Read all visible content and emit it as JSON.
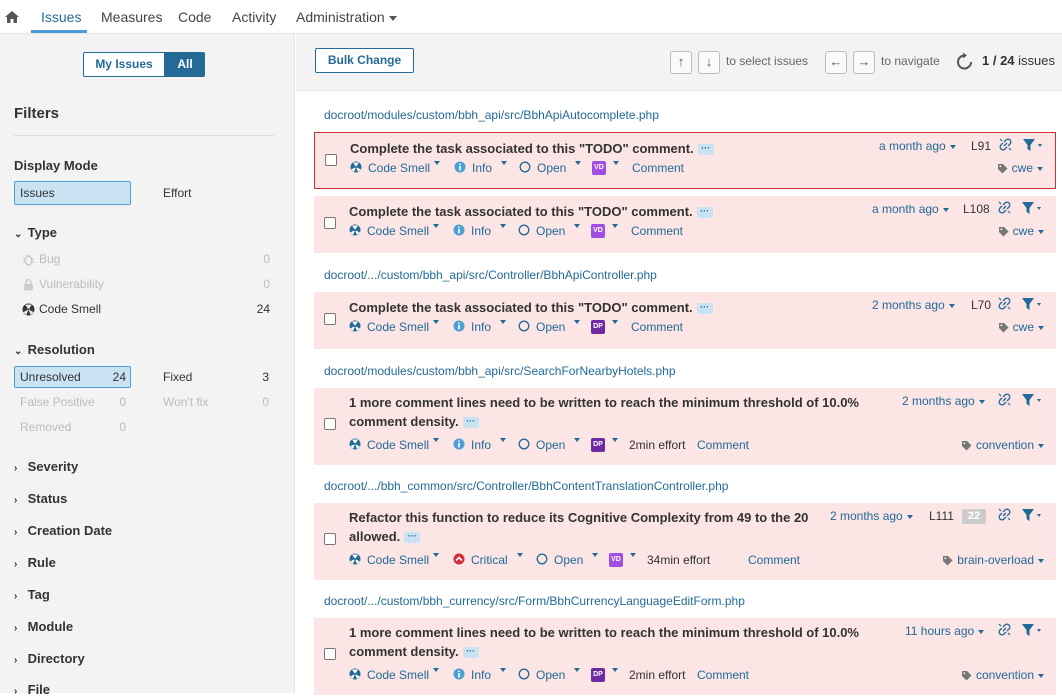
{
  "nav": {
    "items": [
      "Issues",
      "Measures",
      "Code",
      "Activity",
      "Administration"
    ]
  },
  "sidebar": {
    "my_issues": "My Issues",
    "all": "All",
    "filters_title": "Filters",
    "display_mode": {
      "title": "Display Mode",
      "issues": "Issues",
      "effort": "Effort"
    },
    "type": {
      "title": "Type",
      "items": [
        {
          "label": "Bug",
          "count": "0"
        },
        {
          "label": "Vulnerability",
          "count": "0"
        },
        {
          "label": "Code Smell",
          "count": "24"
        }
      ]
    },
    "resolution": {
      "title": "Resolution",
      "items": [
        {
          "label": "Unresolved",
          "count": "24"
        },
        {
          "label": "Fixed",
          "count": "3"
        },
        {
          "label": "False Positive",
          "count": "0"
        },
        {
          "label": "Won't fix",
          "count": "0"
        },
        {
          "label": "Removed",
          "count": "0"
        }
      ]
    },
    "collapsed": [
      "Severity",
      "Status",
      "Creation Date",
      "Rule",
      "Tag",
      "Module",
      "Directory",
      "File"
    ]
  },
  "toolbar": {
    "bulk_change": "Bulk Change",
    "key_up": "↑",
    "key_down": "↓",
    "select_hint": "to select issues",
    "key_left": "←",
    "key_right": "→",
    "navigate_hint": "to navigate",
    "paging_current": "1 / 24",
    "paging_label": "issues"
  },
  "files": [
    "docroot/modules/custom/bbh_api/src/BbhApiAutocomplete.php",
    "docroot/.../custom/bbh_api/src/Controller/BbhApiController.php",
    "docroot/modules/custom/bbh_api/src/SearchForNearbyHotels.php",
    "docroot/.../bbh_common/src/Controller/BbhContentTranslationController.php",
    "docroot/.../custom/bbh_currency/src/Form/BbhCurrencyLanguageEditForm.php"
  ],
  "issues": [
    {
      "msg1": "Complete the task associated to this \"TODO\" comment.",
      "msg2": "",
      "type": "Code Smell",
      "severity": "Info",
      "status": "Open",
      "assignee": "VD",
      "effort": "",
      "comment": "Comment",
      "age": "a month ago",
      "line": "L91",
      "badge": "",
      "tag": "cwe"
    },
    {
      "msg1": "Complete the task associated to this \"TODO\" comment.",
      "msg2": "",
      "type": "Code Smell",
      "severity": "Info",
      "status": "Open",
      "assignee": "VD",
      "effort": "",
      "comment": "Comment",
      "age": "a month ago",
      "line": "L108",
      "badge": "",
      "tag": "cwe"
    },
    {
      "msg1": "Complete the task associated to this \"TODO\" comment.",
      "msg2": "",
      "type": "Code Smell",
      "severity": "Info",
      "status": "Open",
      "assignee": "DP",
      "effort": "",
      "comment": "Comment",
      "age": "2 months ago",
      "line": "L70",
      "badge": "",
      "tag": "cwe"
    },
    {
      "msg1": "1 more comment lines need to be written to reach the minimum threshold of 10.0%",
      "msg2": "comment density.",
      "type": "Code Smell",
      "severity": "Info",
      "status": "Open",
      "assignee": "DP",
      "effort": "2min effort",
      "comment": "Comment",
      "age": "2 months ago",
      "line": "",
      "badge": "",
      "tag": "convention"
    },
    {
      "msg1": "Refactor this function to reduce its Cognitive Complexity from 49 to the 20",
      "msg2": "allowed.",
      "type": "Code Smell",
      "severity": "Critical",
      "status": "Open",
      "assignee": "VD",
      "effort": "34min effort",
      "comment": "Comment",
      "age": "2 months ago",
      "line": "L111",
      "badge": "22",
      "tag": "brain-overload"
    },
    {
      "msg1": "1 more comment lines need to be written to reach the minimum threshold of 10.0%",
      "msg2": "comment density.",
      "type": "Code Smell",
      "severity": "Info",
      "status": "Open",
      "assignee": "DP",
      "effort": "2min effort",
      "comment": "Comment",
      "age": "11 hours ago",
      "line": "",
      "badge": "",
      "tag": "convention"
    }
  ],
  "colors": {
    "accent": "#236a97",
    "issue_bg": "#fbe5e5",
    "selected_border": "#d02f3a",
    "critical": "#d02f3a"
  }
}
